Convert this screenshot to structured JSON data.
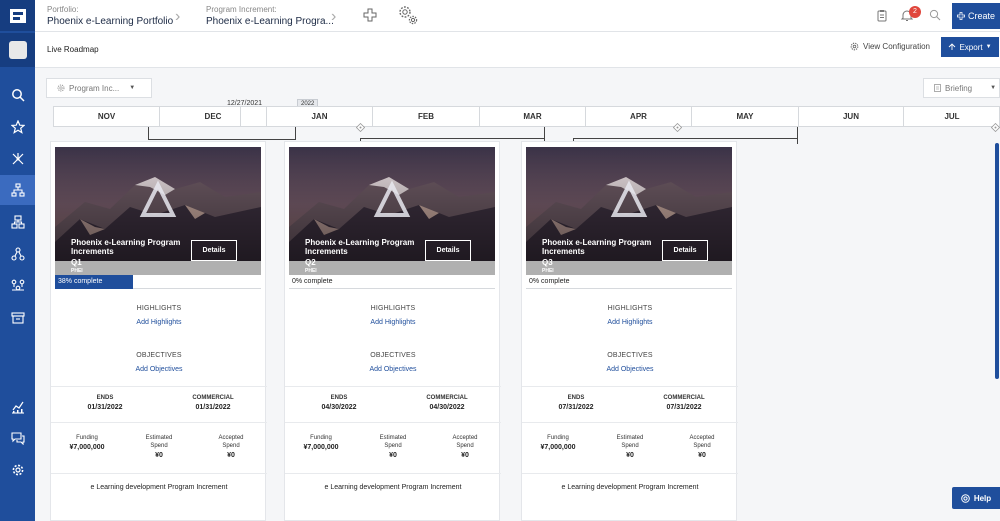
{
  "breadcrumb": {
    "portfolio_key": "Portfolio:",
    "portfolio_value": "Phoenix e-Learning Portfolio",
    "pi_key": "Program Increment:",
    "pi_value": "Phoenix e-Learning Progra..."
  },
  "notifications": {
    "count": "2"
  },
  "create_label": "Create",
  "page_title": "Live Roadmap",
  "view_config_label": "View Configuration",
  "export_label": "Export",
  "filter": {
    "program_increment_label": "Program Inc...",
    "view_label": "Briefing"
  },
  "timeline": {
    "today_date": "12/27/2021",
    "year_tag": "2022",
    "months": [
      "NOV",
      "DEC",
      "JAN",
      "FEB",
      "MAR",
      "APR",
      "MAY",
      "JUN",
      "JUL"
    ]
  },
  "cards": [
    {
      "name": "Phoenix e-Learning Program Increments",
      "quarter": "Q1",
      "code": "PHEI",
      "details_label": "Details",
      "progress_label": "38% complete",
      "progress": 0.38,
      "highlights_title": "HIGHLIGHTS",
      "highlights_link": "Add Highlights",
      "objectives_title": "OBJECTIVES",
      "objectives_link": "Add Objectives",
      "ends_label": "ENDS",
      "ends_value": "01/31/2022",
      "commercial_label": "COMMERCIAL",
      "commercial_value": "01/31/2022",
      "funding_label": "Funding",
      "funding_value": "¥7,000,000",
      "estimated_label": "Estimated Spend",
      "estimated_value": "¥0",
      "accepted_label": "Accepted Spend",
      "accepted_value": "¥0",
      "description": "e Learning development Program Increment"
    },
    {
      "name": "Phoenix e-Learning Program Increments",
      "quarter": "Q2",
      "code": "PHEI",
      "details_label": "Details",
      "progress_label": "0% complete",
      "progress": 0,
      "highlights_title": "HIGHLIGHTS",
      "highlights_link": "Add Highlights",
      "objectives_title": "OBJECTIVES",
      "objectives_link": "Add Objectives",
      "ends_label": "ENDS",
      "ends_value": "04/30/2022",
      "commercial_label": "COMMERCIAL",
      "commercial_value": "04/30/2022",
      "funding_label": "Funding",
      "funding_value": "¥7,000,000",
      "estimated_label": "Estimated Spend",
      "estimated_value": "¥0",
      "accepted_label": "Accepted Spend",
      "accepted_value": "¥0",
      "description": "e Learning development Program Increment"
    },
    {
      "name": "Phoenix e-Learning Program Increments",
      "quarter": "Q3",
      "code": "PHEI",
      "details_label": "Details",
      "progress_label": "0% complete",
      "progress": 0,
      "highlights_title": "HIGHLIGHTS",
      "highlights_link": "Add Highlights",
      "objectives_title": "OBJECTIVES",
      "objectives_link": "Add Objectives",
      "ends_label": "ENDS",
      "ends_value": "07/31/2022",
      "commercial_label": "COMMERCIAL",
      "commercial_value": "07/31/2022",
      "funding_label": "Funding",
      "funding_value": "¥7,000,000",
      "estimated_label": "Estimated Spend",
      "estimated_value": "¥0",
      "accepted_label": "Accepted Spend",
      "accepted_value": "¥0",
      "description": "e Learning development Program Increment"
    }
  ],
  "help_label": "Help",
  "colors": {
    "primary": "#1f4e9c",
    "badge": "#e0463c"
  }
}
